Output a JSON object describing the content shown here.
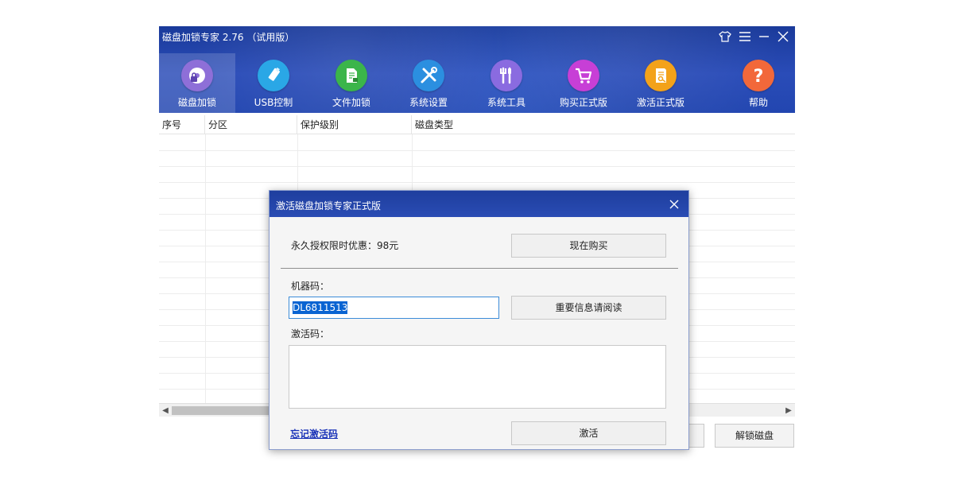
{
  "app": {
    "title": "磁盘加锁专家 2.76 （试用版）",
    "window_controls": [
      "skin-icon",
      "menu-icon",
      "minimize-icon",
      "close-icon"
    ]
  },
  "toolbar": {
    "items": [
      {
        "label": "磁盘加锁",
        "icon": "disk-lock-icon",
        "color": "#8e6fd8",
        "active": true
      },
      {
        "label": "USB控制",
        "icon": "usb-icon",
        "color": "#2aa7e6"
      },
      {
        "label": "文件加锁",
        "icon": "file-lock-icon",
        "color": "#3bb54a"
      },
      {
        "label": "系统设置",
        "icon": "tools-icon",
        "color": "#2b8fe0"
      },
      {
        "label": "系统工具",
        "icon": "wrench-icon",
        "color": "#8a6be0"
      },
      {
        "label": "购买正式版",
        "icon": "cart-icon",
        "color": "#c73fd6"
      },
      {
        "label": "激活正式版",
        "icon": "key-doc-icon",
        "color": "#f3a21a"
      },
      {
        "label": "帮助",
        "icon": "help-icon",
        "color": "#f2683a"
      }
    ]
  },
  "grid": {
    "columns": [
      "序号",
      "分区",
      "保护级别",
      "磁盘类型"
    ]
  },
  "bottom": {
    "unlock_label": "解锁磁盘"
  },
  "dialog": {
    "title": "激活磁盘加锁专家正式版",
    "offer_text": "永久授权限时优惠：98元",
    "buy_now": "现在购买",
    "machine_code_label": "机器码：",
    "machine_code_value": "DL6811513",
    "important_info": "重要信息请阅读",
    "activation_code_label": "激活码：",
    "activation_code_value": "",
    "forgot_link": "忘记激活码",
    "activate": "激活"
  }
}
